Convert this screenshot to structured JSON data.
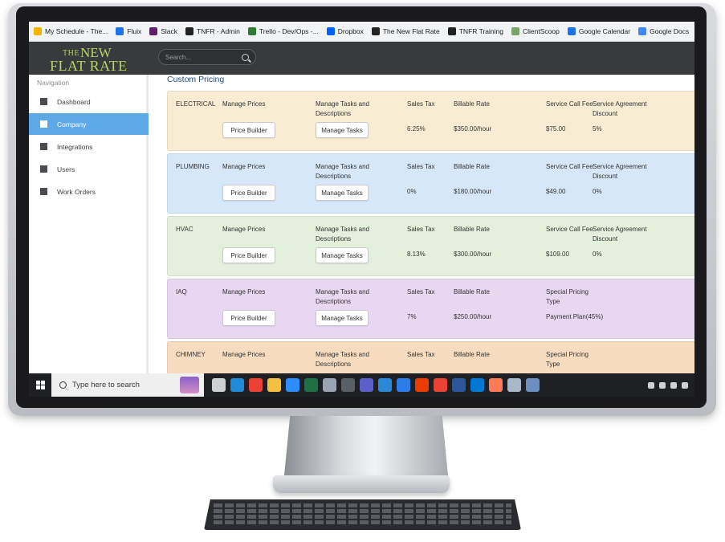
{
  "bookmarks": [
    {
      "label": "My Schedule - The...",
      "color": "#f4b400"
    },
    {
      "label": "Fluix",
      "color": "#1a73e8"
    },
    {
      "label": "Slack",
      "color": "#611f69"
    },
    {
      "label": "TNFR - Admin",
      "color": "#222222"
    },
    {
      "label": "Trello - Dev/Ops -...",
      "color": "#2e7d32"
    },
    {
      "label": "Dropbox",
      "color": "#0061ff"
    },
    {
      "label": "The New Flat Rate",
      "color": "#222222"
    },
    {
      "label": "TNFR Training",
      "color": "#222222"
    },
    {
      "label": "ClientScoop",
      "color": "#7aa36b"
    },
    {
      "label": "Google Calendar",
      "color": "#1a73e8"
    },
    {
      "label": "Google Docs",
      "color": "#4285f4"
    }
  ],
  "header": {
    "logo_small": "THE",
    "logo_new": "NEW",
    "logo_line2": "FLAT RATE",
    "search_placeholder": "Search..."
  },
  "sidebar": {
    "title": "Navigation",
    "items": [
      {
        "label": "Dashboard",
        "icon": "dashboard-icon",
        "active": false
      },
      {
        "label": "Company",
        "icon": "briefcase-icon",
        "active": true
      },
      {
        "label": "Integrations",
        "icon": "integrations-icon",
        "active": false
      },
      {
        "label": "Users",
        "icon": "users-icon",
        "active": false
      },
      {
        "label": "Work Orders",
        "icon": "work-orders-icon",
        "active": false
      }
    ]
  },
  "main": {
    "title": "Custom Pricing",
    "rows": [
      {
        "name": "ELECTRICAL",
        "color": "#f8ecd2",
        "manage_prices": "Manage Prices",
        "price_builder": "Price Builder",
        "manage_tasks": "Manage Tasks and Descriptions",
        "manage_tasks_btn": "Manage Tasks",
        "sales_tax_label": "Sales Tax",
        "sales_tax": "6.25%",
        "billable_rate_label": "Billable Rate",
        "billable_rate": "$350.00/hour",
        "col5_label": "Service Call Fee",
        "col5_value": "$75.00",
        "col6_label": "Service Agreement Discount",
        "col6_value": "5%"
      },
      {
        "name": "PLUMBING",
        "color": "#d6e7f9",
        "manage_prices": "Manage Prices",
        "price_builder": "Price Builder",
        "manage_tasks": "Manage Tasks and Descriptions",
        "manage_tasks_btn": "Manage Tasks",
        "sales_tax_label": "Sales Tax",
        "sales_tax": "0%",
        "billable_rate_label": "Billable Rate",
        "billable_rate": "$180.00/hour",
        "col5_label": "Service Call Fee",
        "col5_value": "$49.00",
        "col6_label": "Service Agreement Discount",
        "col6_value": "0%"
      },
      {
        "name": "HVAC",
        "color": "#e3f1dc",
        "manage_prices": "Manage Prices",
        "price_builder": "Price Builder",
        "manage_tasks": "Manage Tasks and Descriptions",
        "manage_tasks_btn": "Manage Tasks",
        "sales_tax_label": "Sales Tax",
        "sales_tax": "8.13%",
        "billable_rate_label": "Billable Rate",
        "billable_rate": "$300.00/hour",
        "col5_label": "Service Call Fee",
        "col5_value": "$109.00",
        "col6_label": "Service Agreement Discount",
        "col6_value": "0%"
      },
      {
        "name": "IAQ",
        "color": "#e7d7f0",
        "manage_prices": "Manage Prices",
        "price_builder": "Price Builder",
        "manage_tasks": "Manage Tasks and Descriptions",
        "manage_tasks_btn": "Manage Tasks",
        "sales_tax_label": "Sales Tax",
        "sales_tax": "7%",
        "billable_rate_label": "Billable Rate",
        "billable_rate": "$250.00/hour",
        "col5_label": "Special Pricing Type",
        "col5_value": "Payment Plan(45%)",
        "col6_label": "",
        "col6_value": ""
      },
      {
        "name": "CHIMNEY",
        "color": "#f7dcc0",
        "manage_prices": "Manage Prices",
        "price_builder": "",
        "manage_tasks": "Manage Tasks and Descriptions",
        "manage_tasks_btn": "",
        "sales_tax_label": "Sales Tax",
        "sales_tax": "",
        "billable_rate_label": "Billable Rate",
        "billable_rate": "",
        "col5_label": "Special Pricing Type",
        "col5_value": "",
        "col6_label": "",
        "col6_value": ""
      }
    ]
  },
  "taskbar": {
    "search_text": "Type here to search",
    "apps": [
      {
        "name": "task-view-icon",
        "color": "#cfd0d2"
      },
      {
        "name": "edge-icon",
        "color": "#1f8ad8"
      },
      {
        "name": "chrome-icon",
        "color": "#e94235"
      },
      {
        "name": "file-explorer-icon",
        "color": "#f3c03f"
      },
      {
        "name": "zoom-icon",
        "color": "#2d8cff"
      },
      {
        "name": "excel-icon",
        "color": "#1e7145"
      },
      {
        "name": "photos-icon",
        "color": "#9aa3b0"
      },
      {
        "name": "calculator-icon",
        "color": "#5a5f66"
      },
      {
        "name": "teams-icon",
        "color": "#5b5fc7"
      },
      {
        "name": "image-icon",
        "color": "#2b88d8"
      },
      {
        "name": "calendar-icon",
        "color": "#2b7de9"
      },
      {
        "name": "office-icon",
        "color": "#eb3c00"
      },
      {
        "name": "chrome-active-icon",
        "color": "#e94235"
      },
      {
        "name": "word-icon",
        "color": "#2b579a"
      },
      {
        "name": "outlook-icon",
        "color": "#0078d4"
      },
      {
        "name": "hubspot-icon",
        "color": "#ff7a59"
      },
      {
        "name": "pen-icon",
        "color": "#a9b7c6"
      },
      {
        "name": "settings-icon",
        "color": "#6c8ebf"
      }
    ]
  }
}
